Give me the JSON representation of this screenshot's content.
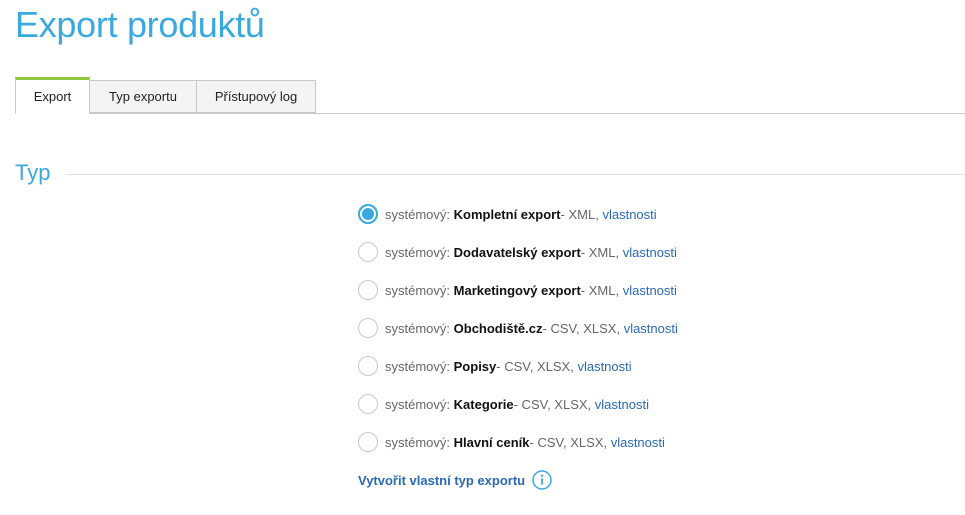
{
  "page": {
    "title": "Export produktů"
  },
  "tabs": [
    {
      "label": "Export",
      "active": true
    },
    {
      "label": "Typ exportu",
      "active": false
    },
    {
      "label": "Přístupový log",
      "active": false
    }
  ],
  "section": {
    "heading": "Typ"
  },
  "export_types": [
    {
      "prefix": "systémový:",
      "name": "Kompletní export",
      "formats": " - XML, ",
      "link": "vlastnosti",
      "selected": true
    },
    {
      "prefix": "systémový:",
      "name": "Dodavatelský export",
      "formats": " - XML, ",
      "link": "vlastnosti",
      "selected": false
    },
    {
      "prefix": "systémový:",
      "name": "Marketingový export",
      "formats": " - XML, ",
      "link": "vlastnosti",
      "selected": false
    },
    {
      "prefix": "systémový:",
      "name": "Obchodiště.cz",
      "formats": " - CSV, XLSX, ",
      "link": "vlastnosti",
      "selected": false
    },
    {
      "prefix": "systémový:",
      "name": "Popisy",
      "formats": " - CSV, XLSX, ",
      "link": "vlastnosti",
      "selected": false
    },
    {
      "prefix": "systémový:",
      "name": "Kategorie",
      "formats": " - CSV, XLSX, ",
      "link": "vlastnosti",
      "selected": false
    },
    {
      "prefix": "systémový:",
      "name": "Hlavní ceník",
      "formats": " - CSV, XLSX, ",
      "link": "vlastnosti",
      "selected": false
    }
  ],
  "create_custom": {
    "label": "Vytvořit vlastní typ exportu",
    "icon": "info-icon"
  },
  "colors": {
    "accent": "#3aa9e0",
    "active_tab": "#8dc63f",
    "link": "#2a6ab4"
  }
}
